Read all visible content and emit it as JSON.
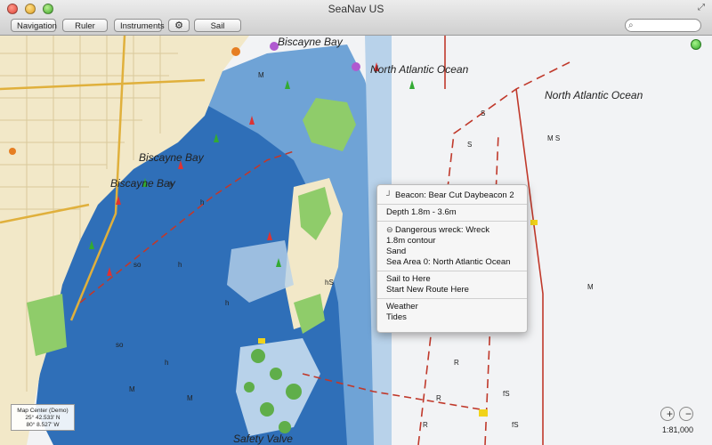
{
  "window": {
    "title": "SeaNav US"
  },
  "toolbar": {
    "navigation_label": "Navigation",
    "ruler_label": "Ruler",
    "instruments_label": "Instruments",
    "sail_label": "Sail",
    "settings_icon": "gear-icon"
  },
  "search": {
    "placeholder": "",
    "icon": "search-icon"
  },
  "map_labels": {
    "biscayne_bay_top": "Biscayne Bay",
    "north_atlantic_1": "North Atlantic Ocean",
    "north_atlantic_2": "North Atlantic Ocean",
    "biscayne_bay_mid": "Biscayne Bay",
    "biscayne_bay_left": "Biscayne Bay",
    "safety_valve": "Safety Valve"
  },
  "popup": {
    "beacon": "Beacon: Bear Cut Daybeacon 2",
    "depth": "Depth 1.8m - 3.6m",
    "wreck": "Dangerous wreck: Wreck",
    "contour": "1.8m contour",
    "bottom": "Sand",
    "sea_area": "Sea Area 0: North Atlantic Ocean",
    "sail_here": "Sail to Here",
    "new_route": "Start New Route Here",
    "weather": "Weather",
    "tides": "Tides"
  },
  "status": {
    "title": "Map Center (Demo)",
    "lat": "25° 42.533' N",
    "lon": "80° 8.527' W"
  },
  "zoom": {
    "in": "+",
    "out": "−"
  },
  "scale": "1:81,000",
  "colors": {
    "ocean": "#f2f3f5",
    "deep_water": "#2f6fb8",
    "medium_water": "#6fa3d6",
    "shallow_water": "#b8d2ea",
    "land": "#f2e8c8",
    "green_land": "#8fcc6a",
    "route_red": "#c0392b"
  }
}
